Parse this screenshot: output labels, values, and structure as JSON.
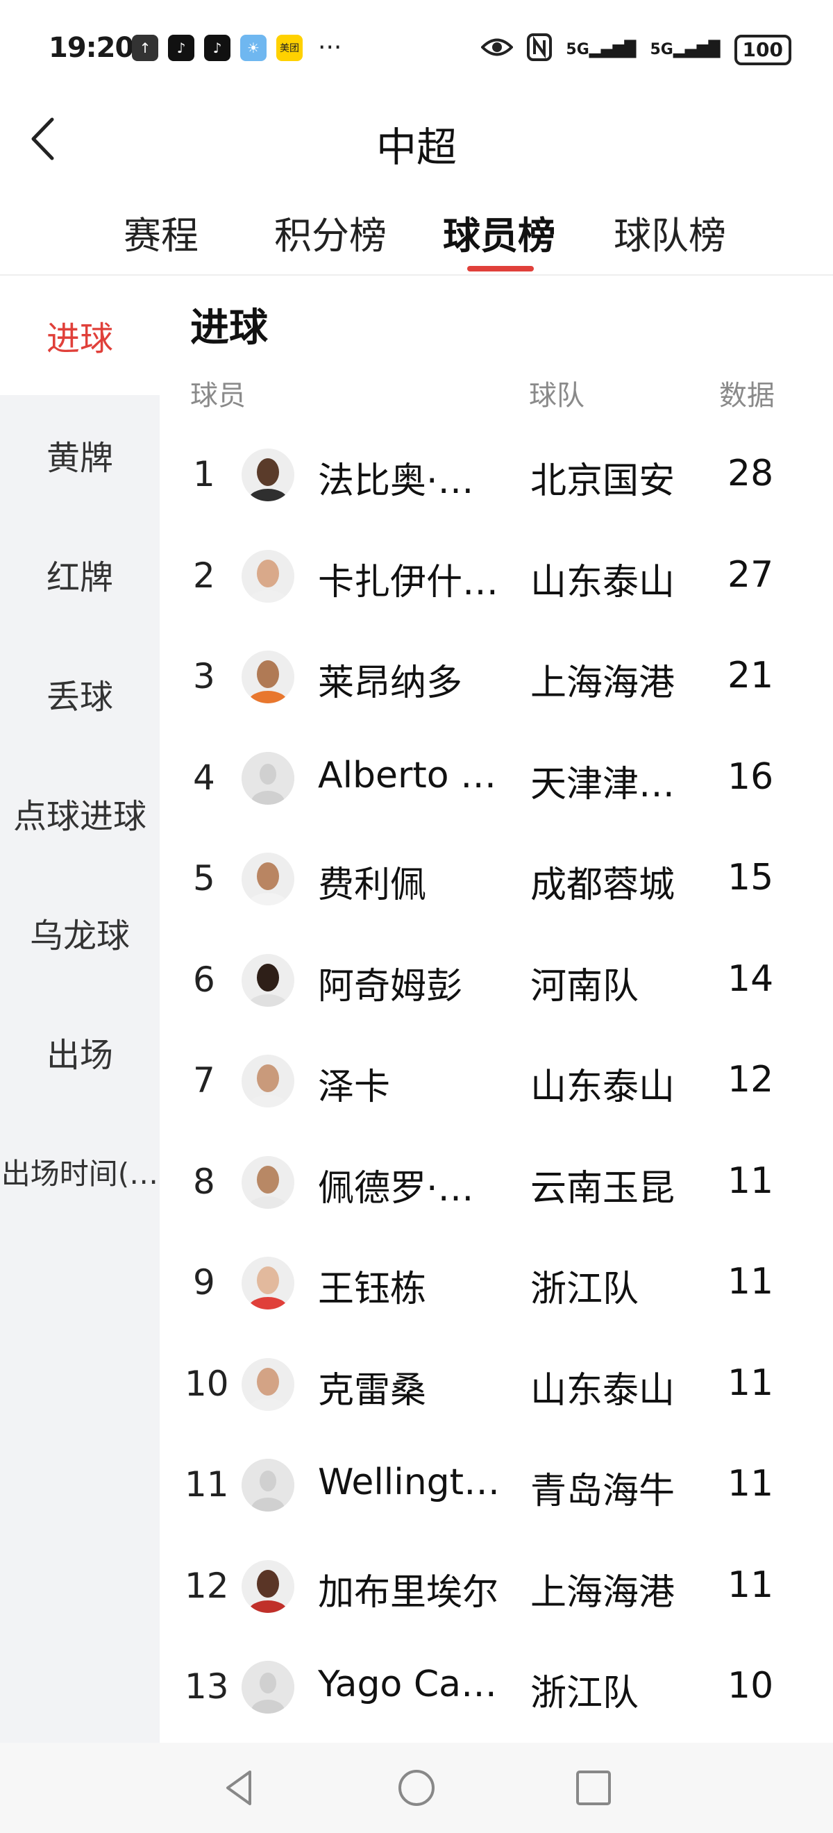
{
  "status_bar": {
    "time": "19:20",
    "app_icons": [
      {
        "name": "upload-app-icon",
        "color": "#333333",
        "glyph": "↑"
      },
      {
        "name": "tiktok-app-icon",
        "color": "#111111",
        "glyph": "♪"
      },
      {
        "name": "tiktok-app-icon-2",
        "color": "#111111",
        "glyph": "♪"
      },
      {
        "name": "weather-app-icon",
        "color": "#6fb7f0",
        "glyph": "☀"
      },
      {
        "name": "meituan-app-icon",
        "color": "#ffd100",
        "glyph": "美团"
      }
    ],
    "more": "···",
    "signal_1": "5G",
    "signal_2": "5G",
    "battery": "100"
  },
  "header": {
    "title": "中超"
  },
  "tabs": [
    {
      "label": "赛程",
      "active": false
    },
    {
      "label": "积分榜",
      "active": false
    },
    {
      "label": "球员榜",
      "active": true
    },
    {
      "label": "球队榜",
      "active": false
    }
  ],
  "sidebar": {
    "items": [
      {
        "label": "进球",
        "active": true
      },
      {
        "label": "黄牌",
        "active": false
      },
      {
        "label": "红牌",
        "active": false
      },
      {
        "label": "丢球",
        "active": false
      },
      {
        "label": "点球进球",
        "active": false
      },
      {
        "label": "乌龙球",
        "active": false
      },
      {
        "label": "出场",
        "active": false
      },
      {
        "label": "出场时间(…",
        "active": false
      }
    ]
  },
  "main": {
    "section_title": "进球",
    "columns": {
      "player": "球员",
      "team": "球队",
      "data": "数据"
    },
    "rows": [
      {
        "rank": "1",
        "name": "法比奥·阿…",
        "team": "北京国安",
        "value": "28",
        "skin": "#5a3b2a",
        "shirt": "#2f2f2f"
      },
      {
        "rank": "2",
        "name": "卡扎伊什维…",
        "team": "山东泰山",
        "value": "27",
        "skin": "#d9a98a",
        "shirt": "#f0f0f0"
      },
      {
        "rank": "3",
        "name": "莱昂纳多",
        "team": "上海海港",
        "value": "21",
        "skin": "#b07a55",
        "shirt": "#e8772e"
      },
      {
        "rank": "4",
        "name": "Alberto Qu…",
        "team": "天津津门…",
        "value": "16",
        "skin": "",
        "shirt": ""
      },
      {
        "rank": "5",
        "name": "费利佩",
        "team": "成都蓉城",
        "value": "15",
        "skin": "#b98562",
        "shirt": "#f3f3f3"
      },
      {
        "rank": "6",
        "name": "阿奇姆彭",
        "team": "河南队",
        "value": "14",
        "skin": "#2e1f18",
        "shirt": "#e0e0e0"
      },
      {
        "rank": "7",
        "name": "泽卡",
        "team": "山东泰山",
        "value": "12",
        "skin": "#c99a7b",
        "shirt": "#f0f0f0"
      },
      {
        "rank": "8",
        "name": "佩德罗·恩…",
        "team": "云南玉昆",
        "value": "11",
        "skin": "#b88865",
        "shirt": "#e9e9e9"
      },
      {
        "rank": "9",
        "name": "王钰栋",
        "team": "浙江队",
        "value": "11",
        "skin": "#e2b99d",
        "shirt": "#e0403a"
      },
      {
        "rank": "10",
        "name": "克雷桑",
        "team": "山东泰山",
        "value": "11",
        "skin": "#d3a385",
        "shirt": "#f0f0f0"
      },
      {
        "rank": "11",
        "name": "Wellington…",
        "team": "青岛海牛",
        "value": "11",
        "skin": "",
        "shirt": ""
      },
      {
        "rank": "12",
        "name": "加布里埃尔",
        "team": "上海海港",
        "value": "11",
        "skin": "#5a3526",
        "shirt": "#c0302a"
      },
      {
        "rank": "13",
        "name": "Yago Cariel…",
        "team": "浙江队",
        "value": "10",
        "skin": "",
        "shirt": ""
      }
    ]
  },
  "colors": {
    "accent": "#e0403a",
    "sidebar_bg": "#f2f3f5",
    "header_text": "#8a8a8a"
  }
}
